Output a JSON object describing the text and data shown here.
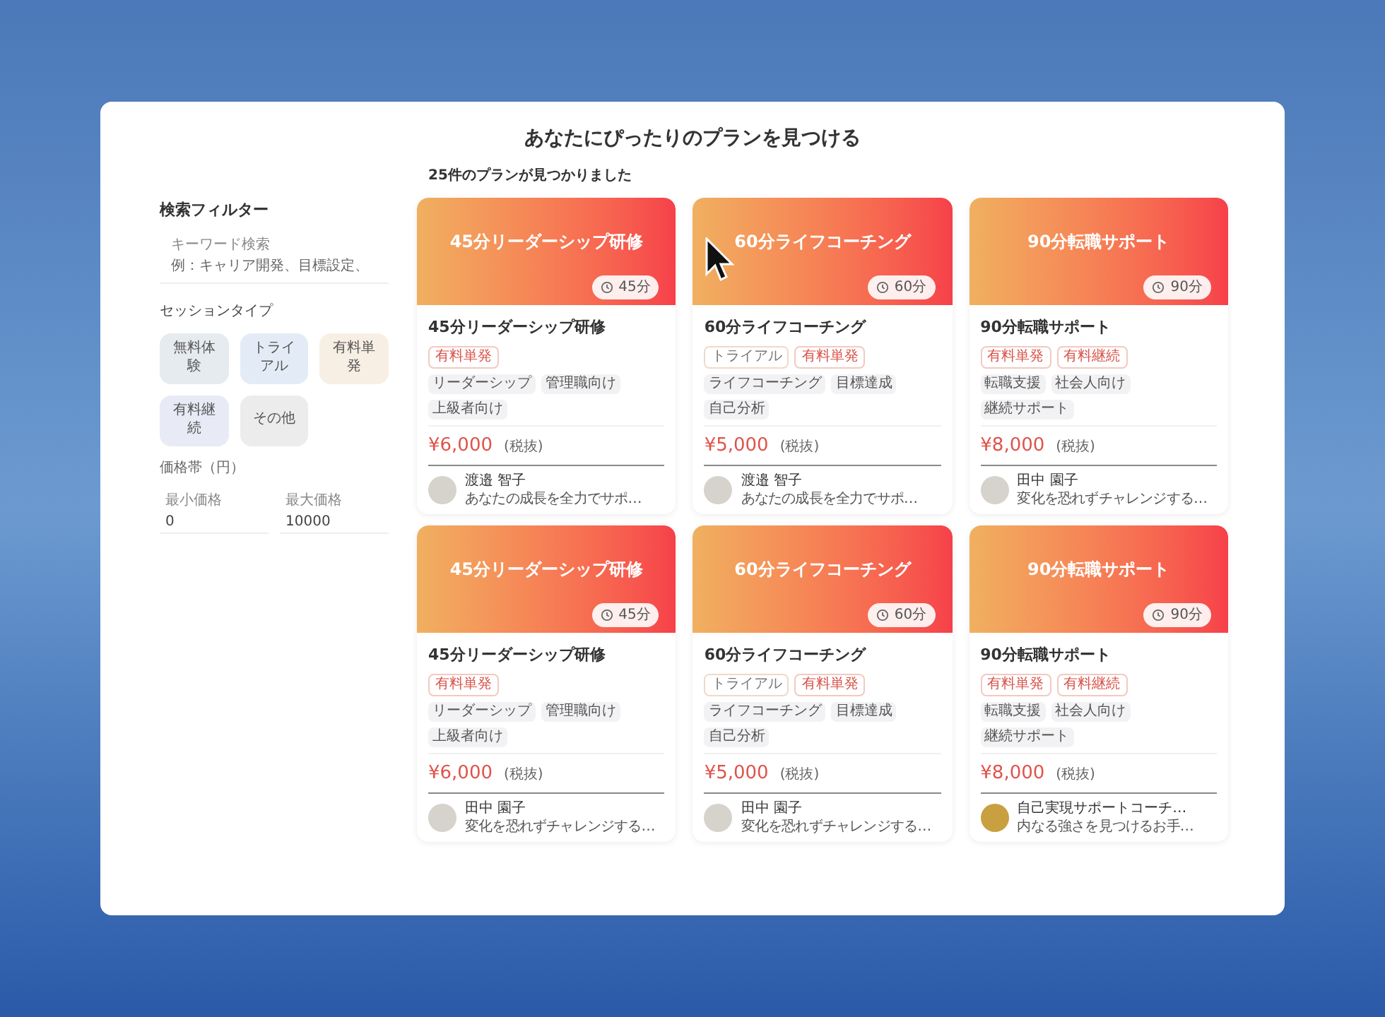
{
  "page_title": "あなたにぴったりのプランを見つける",
  "filter": {
    "heading": "検索フィルター",
    "keyword_label": "キーワード検索",
    "keyword_placeholder": "例：キャリア開発、目標設定、",
    "session_type_label": "セッションタイプ",
    "session_types": [
      {
        "label": "無料体験",
        "color": "#e6ebef"
      },
      {
        "label": "トライアル",
        "color": "#e3ecf6"
      },
      {
        "label": "有料単発",
        "color": "#f8efe4"
      },
      {
        "label": "有料継続",
        "color": "#e8eaf5"
      },
      {
        "label": "その他",
        "color": "#ececec"
      }
    ],
    "price_label": "価格帯（円）",
    "min_label": "最小価格",
    "min_value": "0",
    "max_label": "最大価格",
    "max_value": "10000"
  },
  "result_count": "25件のプランが見つかりました",
  "plans": [
    {
      "banner_title": "45分リーダーシップ研修",
      "duration": "45分",
      "title": "45分リーダーシップ研修",
      "types": [
        {
          "label": "有料単発",
          "kind": "paid"
        }
      ],
      "tags": [
        "リーダーシップ",
        "管理職向け",
        "上級者向け"
      ],
      "price": "¥6,000",
      "tax": "(税抜)",
      "coach": "渡邉 智子",
      "intro": "あなたの成長を全力でサポ…"
    },
    {
      "banner_title": "60分ライフコーチング",
      "duration": "60分",
      "title": "60分ライフコーチング",
      "types": [
        {
          "label": "トライアル",
          "kind": "trial"
        },
        {
          "label": "有料単発",
          "kind": "paid"
        }
      ],
      "tags": [
        "ライフコーチング",
        "目標達成",
        "自己分析"
      ],
      "price": "¥5,000",
      "tax": "(税抜)",
      "coach": "渡邉 智子",
      "intro": "あなたの成長を全力でサポ…"
    },
    {
      "banner_title": "90分転職サポート",
      "duration": "90分",
      "title": "90分転職サポート",
      "types": [
        {
          "label": "有料単発",
          "kind": "paid"
        },
        {
          "label": "有料継続",
          "kind": "paid"
        }
      ],
      "tags": [
        "転職支援",
        "社会人向け",
        "継続サポート"
      ],
      "price": "¥8,000",
      "tax": "(税抜)",
      "coach": "田中 園子",
      "intro": "変化を恐れずチャレンジする…"
    },
    {
      "banner_title": "45分リーダーシップ研修",
      "duration": "45分",
      "title": "45分リーダーシップ研修",
      "types": [
        {
          "label": "有料単発",
          "kind": "paid"
        }
      ],
      "tags": [
        "リーダーシップ",
        "管理職向け",
        "上級者向け"
      ],
      "price": "¥6,000",
      "tax": "(税抜)",
      "coach": "田中 園子",
      "intro": "変化を恐れずチャレンジする…"
    },
    {
      "banner_title": "60分ライフコーチング",
      "duration": "60分",
      "title": "60分ライフコーチング",
      "types": [
        {
          "label": "トライアル",
          "kind": "trial"
        },
        {
          "label": "有料単発",
          "kind": "paid"
        }
      ],
      "tags": [
        "ライフコーチング",
        "目標達成",
        "自己分析"
      ],
      "price": "¥5,000",
      "tax": "(税抜)",
      "coach": "田中 園子",
      "intro": "変化を恐れずチャレンジする…"
    },
    {
      "banner_title": "90分転職サポート",
      "duration": "90分",
      "title": "90分転職サポート",
      "types": [
        {
          "label": "有料単発",
          "kind": "paid"
        },
        {
          "label": "有料継続",
          "kind": "paid"
        }
      ],
      "tags": [
        "転職支援",
        "社会人向け",
        "継続サポート"
      ],
      "price": "¥8,000",
      "tax": "(税抜)",
      "coach": "自己実現サポートコーチ…",
      "intro": "内なる強さを見つけるお手…"
    }
  ]
}
